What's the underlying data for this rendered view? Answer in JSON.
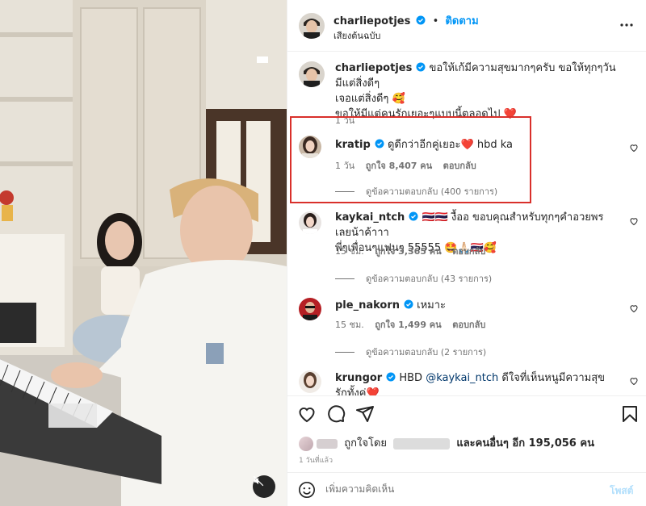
{
  "colors": {
    "accent": "#0095f6",
    "verified": "#0095f6",
    "highlight_box": "#d9302b",
    "heart": "#e0245e",
    "muted_text": "#737373"
  },
  "header": {
    "username": "charliepotjes",
    "separator": "•",
    "follow_label": "ติดตาม",
    "subtitle": "เสียงต้นฉบับ",
    "more_icon": "more-horizontal-icon"
  },
  "caption": {
    "username": "charliepotjes",
    "line1": "ขอให้เก้มีความสุขมากๆครับ ขอให้ทุกๆวันมีแต่สิ่งดีๆ",
    "line2": "เจอแต่สิ่งดีๆ 🥰",
    "line3": "ขอให้มีแต่คนรักเยอะๆแบบนี้ตลอดไป ❤️",
    "time": "1 วัน"
  },
  "comments": [
    {
      "username": "kratip",
      "text": "ดูดีกว่าอีกคู่เยอะ❤️ hbd ka",
      "time": "1 วัน",
      "likes": "ถูกใจ 8,407 คน",
      "reply": "ตอบกลับ",
      "view_replies": "ดูข้อความตอบกลับ (400 รายการ)"
    },
    {
      "username": "kaykai_ntch",
      "text": "🇹🇭🇹🇭 งื้ออ ขอบคุณสำหรับทุกๆคำอวยพรเลยน้าค้าาา",
      "text2": "พี่ๆเพื่อนๆแฟนๆ 55555 🤩🙏🏻🇹🇭🥰",
      "time": "15 ชม.",
      "likes": "ถูกใจ 3,365 คน",
      "reply": "ตอบกลับ",
      "view_replies": "ดูข้อความตอบกลับ (43 รายการ)"
    },
    {
      "username": "ple_nakorn",
      "text": "เหมาะ",
      "time": "15 ชม.",
      "likes": "ถูกใจ 1,499 คน",
      "reply": "ตอบกลับ",
      "view_replies": "ดูข้อความตอบกลับ (2 รายการ)"
    },
    {
      "username": "krungor",
      "text_prefix": "HBD",
      "mention": "@kaykai_ntch",
      "text": "ดีใจที่เห็นหนูมีความสุข รักทั้งคู่❤️"
    }
  ],
  "actions": {
    "like_icon": "heart-icon",
    "comment_icon": "comment-icon",
    "share_icon": "send-icon",
    "save_icon": "bookmark-icon"
  },
  "likes": {
    "liked_by": "ถูกใจโดย",
    "and_others": "และคนอื่นๆ อีก 195,056 คน"
  },
  "time_ago": "1 วันที่แล้ว",
  "comment_box": {
    "placeholder": "เพิ่มความคิดเห็น",
    "post_label": "โพสต์"
  }
}
